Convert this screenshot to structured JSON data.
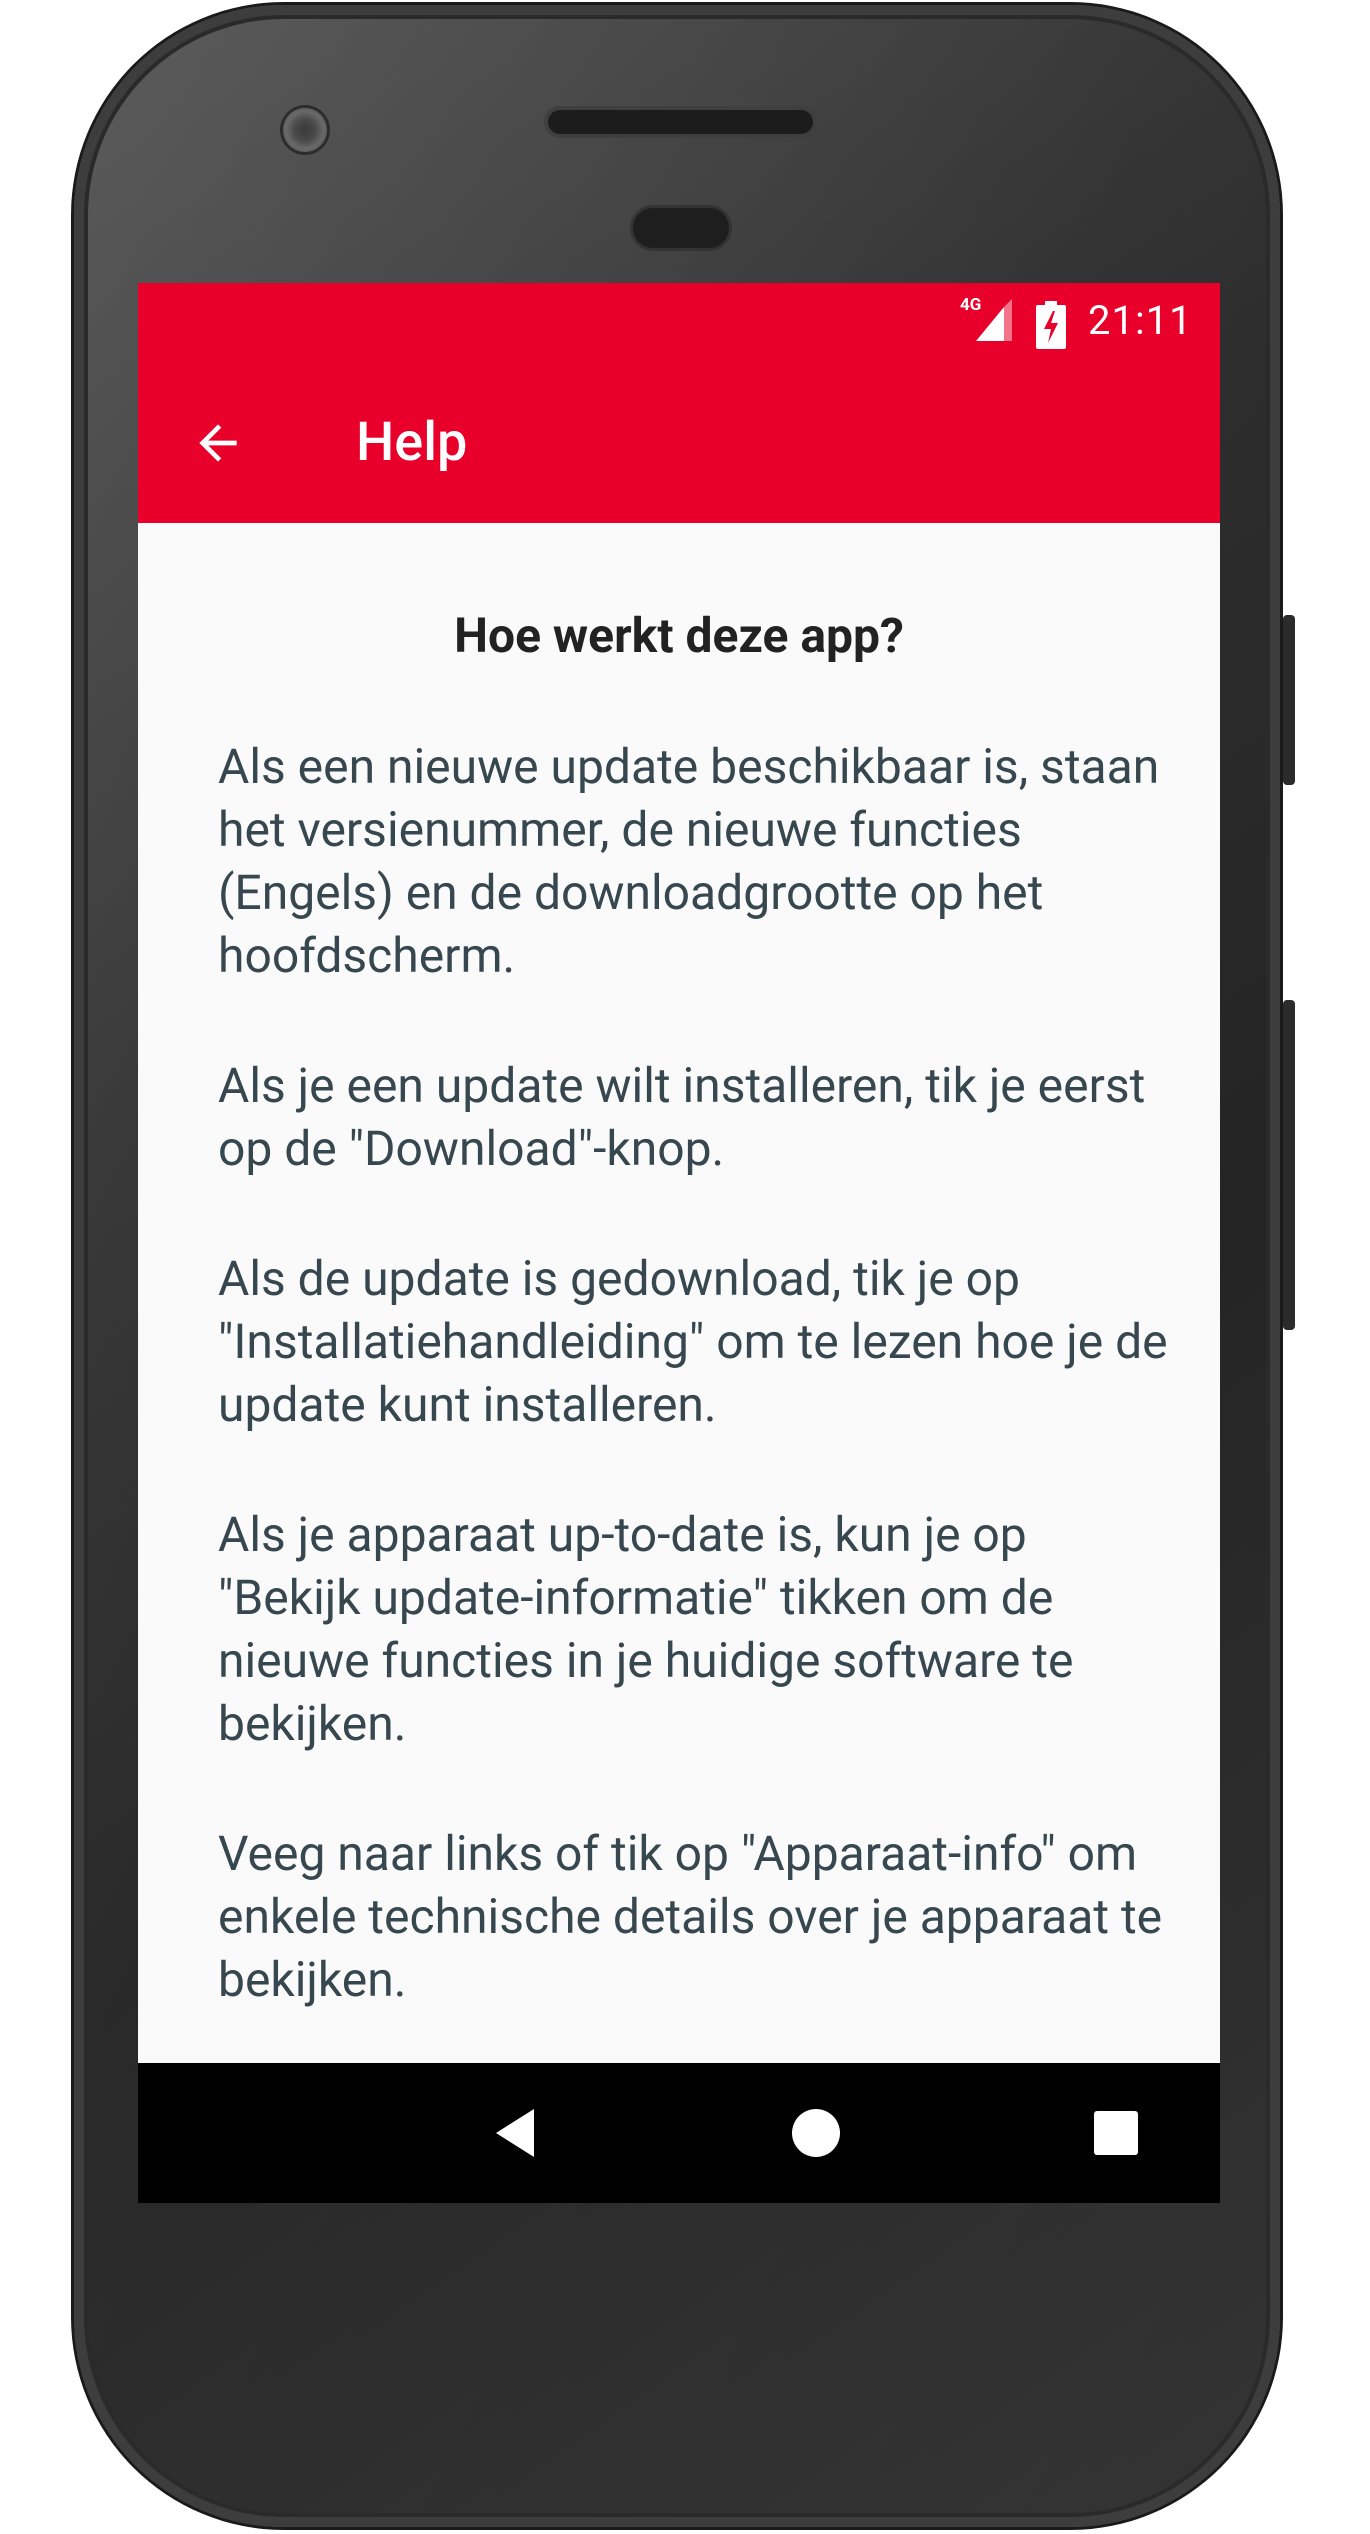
{
  "status_bar": {
    "network": "4G",
    "time": "21:11"
  },
  "toolbar": {
    "back_icon": "arrow-left-icon",
    "title": "Help"
  },
  "content": {
    "heading": "Hoe werkt deze app?",
    "paragraphs": [
      "Als een nieuwe update beschikbaar is, staan het versienummer, de nieuwe functies (Engels) en de downloadgrootte op het hoofdscherm.",
      "Als je een update wilt installeren, tik je eerst op de \"Download\"-knop.",
      "Als de update is gedownload, tik je op \"Installatiehandleiding\" om te lezen hoe je de update kunt installeren.",
      "Als je apparaat up-to-date is, kun je op \"Bekijk update-informatie\" tikken om de nieuwe functies in je huidige software te bekijken.",
      "Veeg naar links of tik op \"Apparaat-info\" om enkele technische details over je apparaat te bekijken."
    ]
  },
  "navigation_bar": {
    "back_icon": "triangle-back-icon",
    "home_icon": "circle-home-icon",
    "recents_icon": "square-recents-icon"
  },
  "colors": {
    "accent": "#e8002b",
    "body_text": "#37474f",
    "heading_text": "#222222",
    "background": "#fafafa"
  }
}
